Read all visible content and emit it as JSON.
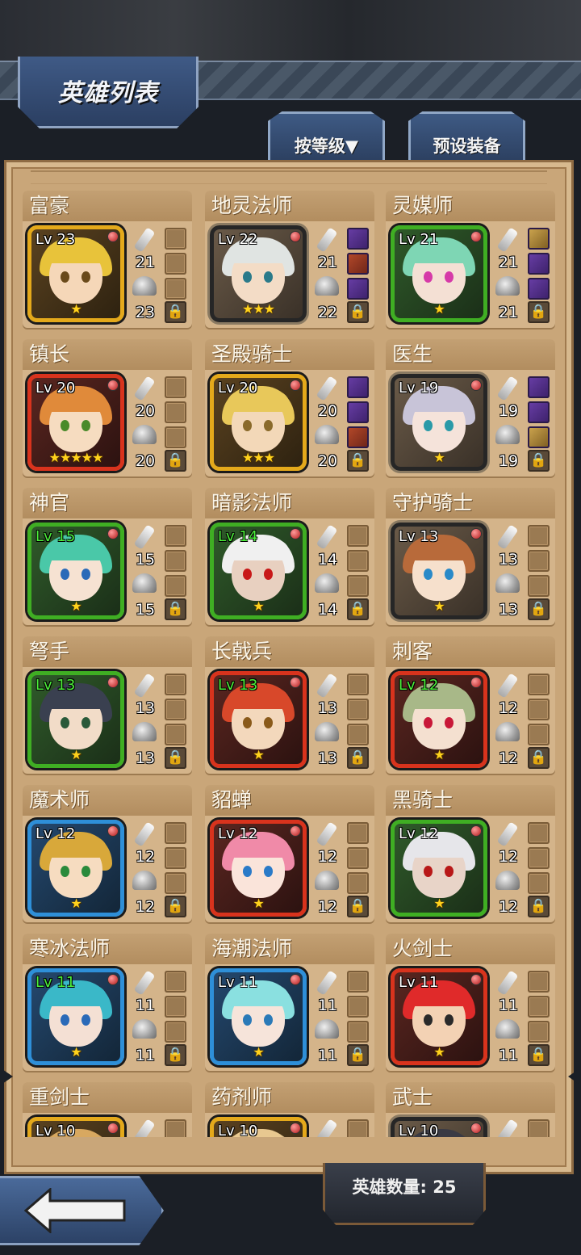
{
  "header": {
    "title": "英雄列表"
  },
  "tabs": [
    {
      "label": "按等级▼"
    },
    {
      "label": "预设装备"
    }
  ],
  "heroes": [
    {
      "name": "富豪",
      "level": "Lv 23",
      "stars": "★",
      "atk": "21",
      "def": "23",
      "frame": "gold",
      "levelColor": "white",
      "hair": "#e8c33a",
      "skin": "#f5d7b8",
      "eye": "#6a4a1a",
      "slots": [
        "empty",
        "empty",
        "empty"
      ]
    },
    {
      "name": "地灵法师",
      "level": "Lv 22",
      "stars": "★★★",
      "atk": "21",
      "def": "22",
      "frame": "gray",
      "levelColor": "white",
      "hair": "#e0e4e2",
      "skin": "#f3dcc6",
      "eye": "#2a7a8a",
      "slots": [
        "filled",
        "red",
        "filled"
      ]
    },
    {
      "name": "灵媒师",
      "level": "Lv 21",
      "stars": "★",
      "atk": "21",
      "def": "21",
      "frame": "green",
      "levelColor": "white",
      "hair": "#7ed6b4",
      "skin": "#f4e0d4",
      "eye": "#d63aa8",
      "slots": [
        "gold",
        "filled",
        "filled"
      ]
    },
    {
      "name": "镇长",
      "level": "Lv 20",
      "stars": "★★★★★",
      "atk": "20",
      "def": "20",
      "frame": "red",
      "levelColor": "white",
      "hair": "#e08a3a",
      "skin": "#f6dcc0",
      "eye": "#4a8a2a",
      "slots": [
        "empty",
        "empty",
        "empty"
      ]
    },
    {
      "name": "圣殿骑士",
      "level": "Lv 20",
      "stars": "★★★",
      "atk": "20",
      "def": "20",
      "frame": "gold",
      "levelColor": "white",
      "hair": "#e8c85a",
      "skin": "#f3d8b8",
      "eye": "#8a6a2a",
      "slots": [
        "filled",
        "filled",
        "red"
      ]
    },
    {
      "name": "医生",
      "level": "Lv 19",
      "stars": "★",
      "atk": "19",
      "def": "19",
      "frame": "gray",
      "levelColor": "white",
      "hair": "#c8c4d8",
      "skin": "#f5e3da",
      "eye": "#2a9aa8",
      "slots": [
        "filled",
        "filled",
        "gold"
      ]
    },
    {
      "name": "神官",
      "level": "Lv 15",
      "stars": "★",
      "atk": "15",
      "def": "15",
      "frame": "green",
      "levelColor": "green",
      "hair": "#4ac8a8",
      "skin": "#f6e2d2",
      "eye": "#2a6ab8",
      "slots": [
        "empty",
        "empty",
        "empty"
      ]
    },
    {
      "name": "暗影法师",
      "level": "Lv 14",
      "stars": "★",
      "atk": "14",
      "def": "14",
      "frame": "green",
      "levelColor": "green",
      "hair": "#f0f0f0",
      "skin": "#e8d0c0",
      "eye": "#c81818",
      "slots": [
        "empty",
        "empty",
        "empty"
      ]
    },
    {
      "name": "守护骑士",
      "level": "Lv 13",
      "stars": "★",
      "atk": "13",
      "def": "13",
      "frame": "gray",
      "levelColor": "white",
      "hair": "#b86a3a",
      "skin": "#f6e0cc",
      "eye": "#2a8ac8",
      "slots": [
        "empty",
        "empty",
        "empty"
      ]
    },
    {
      "name": "弩手",
      "level": "Lv 13",
      "stars": "★",
      "atk": "13",
      "def": "13",
      "frame": "green",
      "levelColor": "green",
      "hair": "#3a4050",
      "skin": "#f2dcc8",
      "eye": "#2a5a3a",
      "slots": [
        "empty",
        "empty",
        "empty"
      ]
    },
    {
      "name": "长戟兵",
      "level": "Lv 13",
      "stars": "★",
      "atk": "13",
      "def": "13",
      "frame": "red",
      "levelColor": "green",
      "hair": "#d8482a",
      "skin": "#f3d8bc",
      "eye": "#8a5a1a",
      "slots": [
        "empty",
        "empty",
        "empty"
      ]
    },
    {
      "name": "刺客",
      "level": "Lv 12",
      "stars": "★",
      "atk": "12",
      "def": "12",
      "frame": "red",
      "levelColor": "green",
      "hair": "#a8b888",
      "skin": "#f4e0d0",
      "eye": "#c81838",
      "slots": [
        "empty",
        "empty",
        "empty"
      ]
    },
    {
      "name": "魔术师",
      "level": "Lv 12",
      "stars": "★",
      "atk": "12",
      "def": "12",
      "frame": "blue",
      "levelColor": "white",
      "hair": "#d8a83a",
      "skin": "#f6dcc0",
      "eye": "#2a8a3a",
      "slots": [
        "empty",
        "empty",
        "empty"
      ]
    },
    {
      "name": "貂蝉",
      "level": "Lv 12",
      "stars": "★",
      "atk": "12",
      "def": "12",
      "frame": "red",
      "levelColor": "white",
      "hair": "#f08aa8",
      "skin": "#fae4da",
      "eye": "#2a7ac8",
      "slots": [
        "empty",
        "empty",
        "empty"
      ]
    },
    {
      "name": "黑骑士",
      "level": "Lv 12",
      "stars": "★",
      "atk": "12",
      "def": "12",
      "frame": "green",
      "levelColor": "white",
      "hair": "#e6e6ea",
      "skin": "#e8d4c8",
      "eye": "#b81818",
      "slots": [
        "empty",
        "empty",
        "empty"
      ]
    },
    {
      "name": "寒冰法师",
      "level": "Lv 11",
      "stars": "★",
      "atk": "11",
      "def": "11",
      "frame": "blue",
      "levelColor": "green",
      "hair": "#3ab8c8",
      "skin": "#f4e0d4",
      "eye": "#2a6ab8",
      "slots": [
        "empty",
        "empty",
        "empty"
      ]
    },
    {
      "name": "海潮法师",
      "level": "Lv 11",
      "stars": "★",
      "atk": "11",
      "def": "11",
      "frame": "blue",
      "levelColor": "white",
      "hair": "#8ae0e0",
      "skin": "#f6e4da",
      "eye": "#2a7ab8",
      "slots": [
        "empty",
        "empty",
        "empty"
      ]
    },
    {
      "name": "火剑士",
      "level": "Lv 11",
      "stars": "★",
      "atk": "11",
      "def": "11",
      "frame": "red",
      "levelColor": "white",
      "hair": "#e02a2a",
      "skin": "#f3d2b4",
      "eye": "#2a2a2a",
      "slots": [
        "empty",
        "empty",
        "empty"
      ]
    },
    {
      "name": "重剑士",
      "level": "Lv 10",
      "stars": "",
      "atk": "",
      "def": "",
      "frame": "gold",
      "levelColor": "white",
      "hair": "#d8a860",
      "skin": "#f3d8bc",
      "eye": "#6a4a2a",
      "slots": [
        "empty",
        "empty",
        "empty"
      ]
    },
    {
      "name": "药剂师",
      "level": "Lv 10",
      "stars": "",
      "atk": "",
      "def": "",
      "frame": "gold",
      "levelColor": "white",
      "hair": "#e8c890",
      "skin": "#f6e0cc",
      "eye": "#6a4a2a",
      "slots": [
        "empty",
        "empty",
        "empty"
      ]
    },
    {
      "name": "武士",
      "level": "Lv 10",
      "stars": "",
      "atk": "",
      "def": "",
      "frame": "gray",
      "levelColor": "white",
      "hair": "#3a3a44",
      "skin": "#f0d8c4",
      "eye": "#2a2a2a",
      "slots": [
        "empty",
        "empty",
        "empty"
      ]
    }
  ],
  "footer": {
    "hero_count": "英雄数量: 25"
  },
  "colors": {
    "panel": "#c9a679",
    "card": "#d4b48a",
    "accent_blue": "#3e5a84",
    "star": "#ffd21c"
  }
}
